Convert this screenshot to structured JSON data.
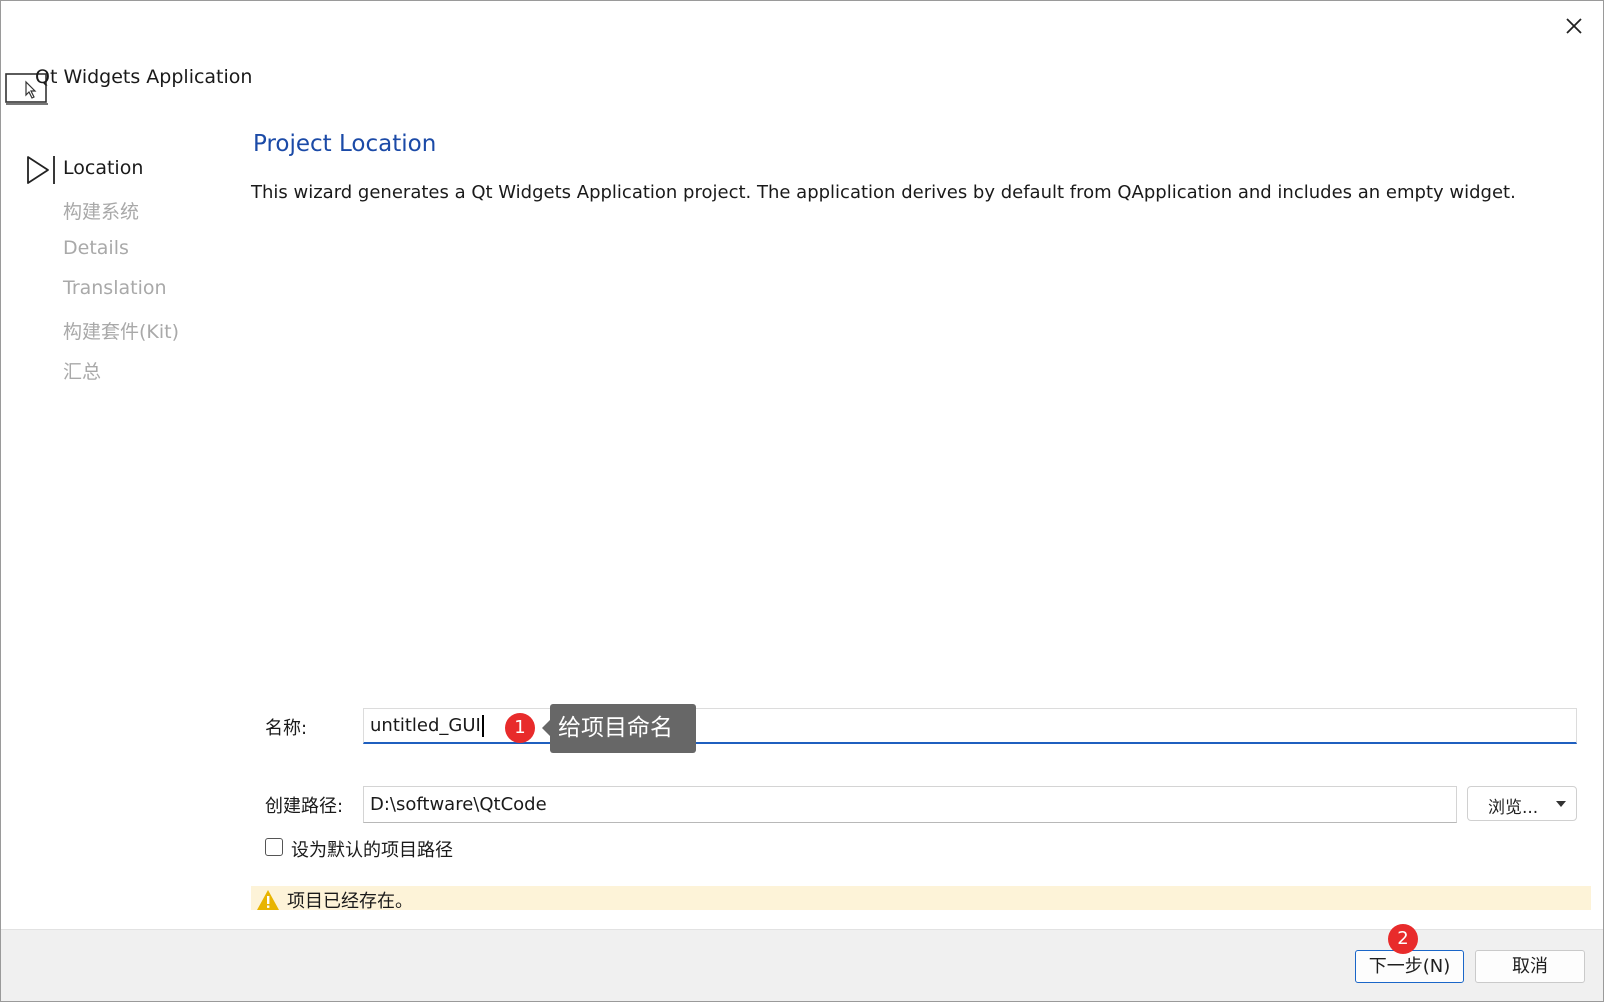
{
  "window": {
    "title": "Qt Widgets Application"
  },
  "steps": [
    {
      "label": "Location",
      "active": true
    },
    {
      "label": "构建系统",
      "active": false
    },
    {
      "label": "Details",
      "active": false
    },
    {
      "label": "Translation",
      "active": false
    },
    {
      "label": "构建套件(Kit)",
      "active": false
    },
    {
      "label": "汇总",
      "active": false
    }
  ],
  "page": {
    "title": "Project Location",
    "description": "This wizard generates a Qt Widgets Application project. The application derives by default from QApplication and includes an empty widget."
  },
  "form": {
    "name_label": "名称:",
    "name_value": "untitled_GUI",
    "path_label": "创建路径:",
    "path_value": "D:\\software\\QtCode",
    "browse_label": "浏览...",
    "default_checkbox_label": "设为默认的项目路径",
    "default_checked": false
  },
  "warning": {
    "text": "项目已经存在。"
  },
  "buttons": {
    "next": "下一步(N)",
    "cancel": "取消"
  },
  "annotations": {
    "badge1": "1",
    "callout1": "给项目命名",
    "badge2": "2"
  },
  "colors": {
    "accent": "#1b4aa7",
    "badge": "#e82b2b",
    "warning_bg": "#fdf3d8",
    "callout_bg": "#676767"
  }
}
